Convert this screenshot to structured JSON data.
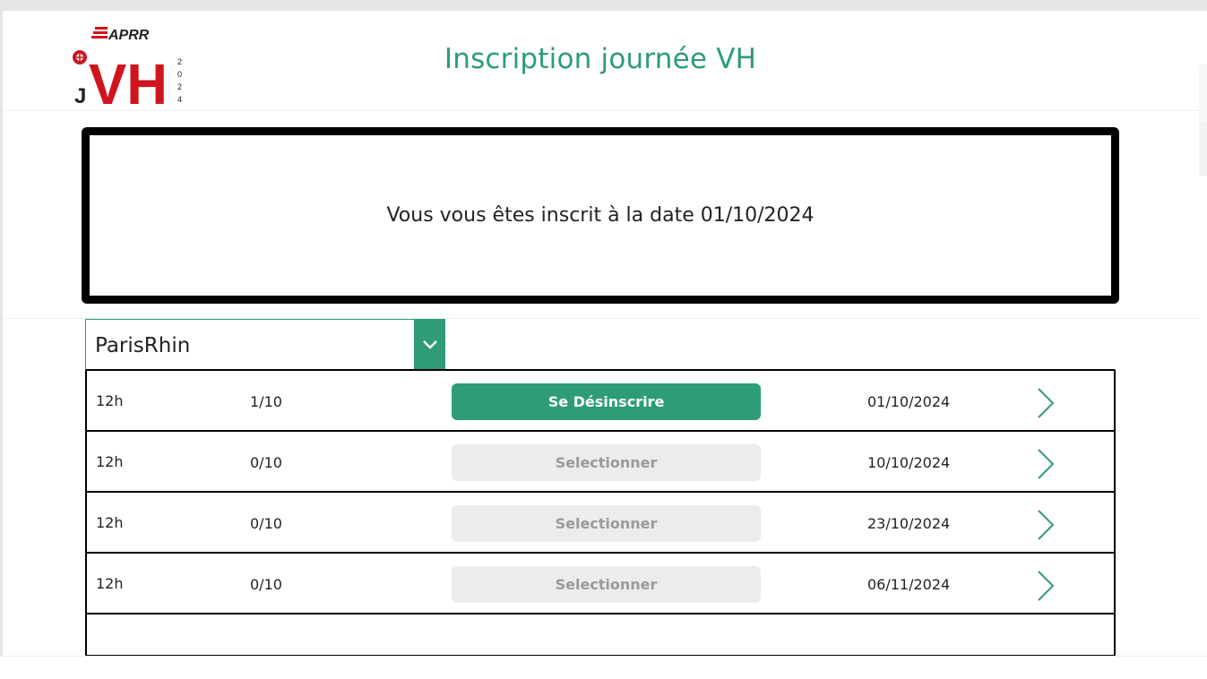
{
  "header": {
    "logo_brand": "APRR",
    "logo_mark": "VH",
    "logo_prefix": "J",
    "logo_year": "2024",
    "title": "Inscription journée VH"
  },
  "message": {
    "text": "Vous vous êtes inscrit à la date 01/10/2024"
  },
  "site_select": {
    "value": "ParisRhin",
    "icon": "chevron-down-icon"
  },
  "slots": [
    {
      "time": "12h",
      "count": "1/10",
      "button": "Se Désinscrire",
      "state": "active",
      "date": "01/10/2024"
    },
    {
      "time": "12h",
      "count": "0/10",
      "button": "Selectionner",
      "state": "inactive",
      "date": "10/10/2024"
    },
    {
      "time": "12h",
      "count": "0/10",
      "button": "Selectionner",
      "state": "inactive",
      "date": "23/10/2024"
    },
    {
      "time": "12h",
      "count": "0/10",
      "button": "Selectionner",
      "state": "inactive",
      "date": "06/11/2024"
    }
  ],
  "colors": {
    "accent": "#2e9c79",
    "button_inactive_bg": "#ececec",
    "button_inactive_text": "#9a9a9a",
    "logo_red": "#d0141e"
  }
}
